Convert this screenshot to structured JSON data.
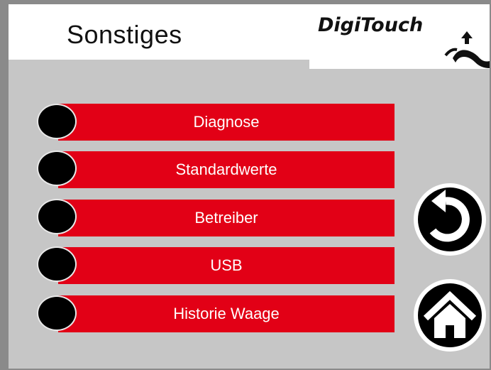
{
  "header": {
    "title": "Sonstiges",
    "logo_text": "DigiTouch"
  },
  "menu": {
    "items": [
      {
        "label": "Diagnose"
      },
      {
        "label": "Standardwerte"
      },
      {
        "label": "Betreiber"
      },
      {
        "label": "USB"
      },
      {
        "label": "Historie Waage"
      }
    ]
  },
  "nav": {
    "back_icon": "back-arrow-icon",
    "home_icon": "home-icon"
  },
  "colors": {
    "background": "#c6c6c6",
    "button_red": "#e20016",
    "bullet": "#000000",
    "text_on_red": "#ffffff"
  }
}
